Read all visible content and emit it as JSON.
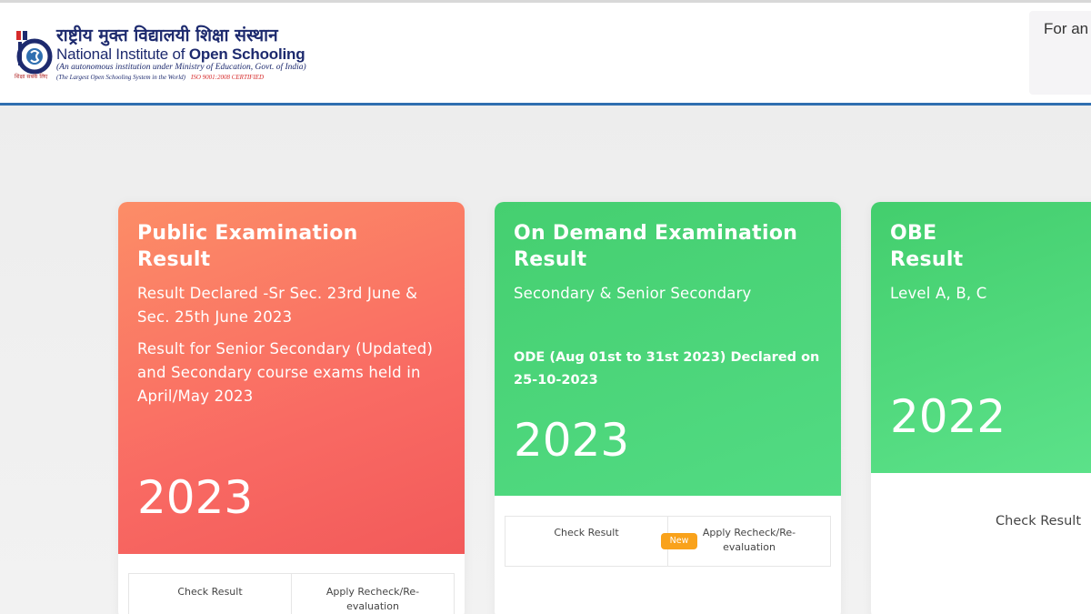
{
  "header": {
    "logo": {
      "hindi_name": "राष्ट्रीय मुक्त विद्यालयी शिक्षा संस्थान",
      "english_name_prefix": "National Institute of ",
      "english_name_bold": "Open Schooling",
      "subtitle": "(An autonomous institution under Ministry of Education, Govt. of India)",
      "tagline": "(The Largest Open Schooling System in the World)",
      "iso": "ISO 9001:2008 CERTIFIED",
      "emblem_caption": "शिक्षा सबके लिए"
    },
    "right_box_text": "For an"
  },
  "cards": [
    {
      "title_line1": "Public Examination",
      "title_line2": "Result",
      "description": "Result Declared -Sr Sec. 23rd June & Sec. 25th June 2023",
      "description2": "Result for Senior Secondary (Updated) and Secondary course exams held in April/May 2023",
      "year": "2023",
      "actions": [
        "Check Result",
        "Apply Recheck/Re-evaluation"
      ]
    },
    {
      "title_line1": "On Demand Examination",
      "title_line2": "Result",
      "description": "Secondary & Senior Secondary",
      "note": "ODE (Aug 01st to 31st 2023) Declared on 25-10-2023",
      "year": "2023",
      "actions": [
        "Check Result",
        "Apply Recheck/Re-evaluation"
      ],
      "badge": "New"
    },
    {
      "title_line1": "OBE",
      "title_line2": "Result",
      "description": "Level A, B, C",
      "year": "2022",
      "actions": [
        "Check Result"
      ]
    }
  ],
  "colors": {
    "header_border": "#2f6fb0",
    "card1_gradient_start": "#fc8d67",
    "card1_gradient_end": "#f25a5a",
    "card2_green": "#4cd67a",
    "badge_orange": "#f9a21b",
    "logo_navy": "#1d2a6e"
  }
}
